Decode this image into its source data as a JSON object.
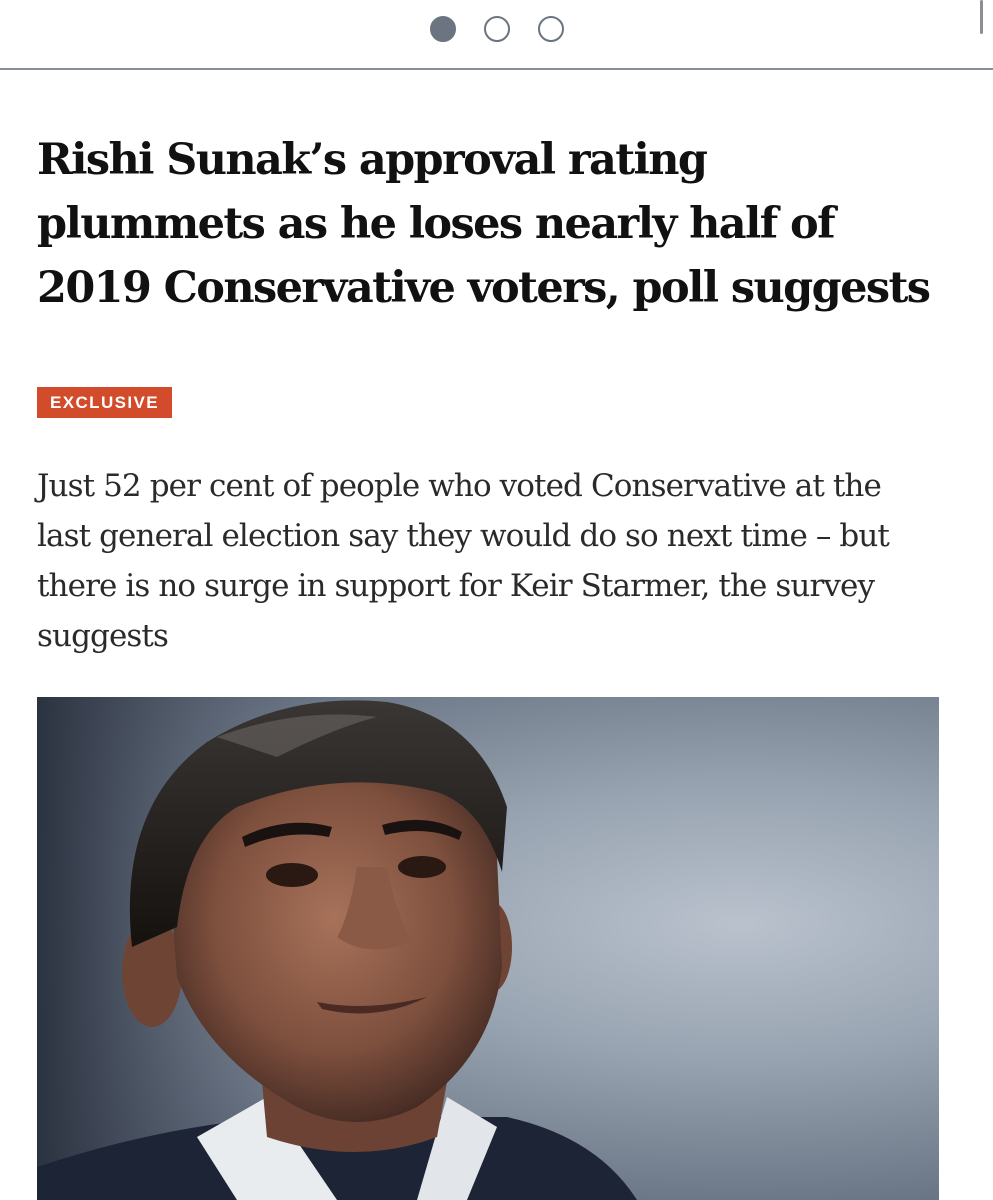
{
  "carousel": {
    "total": 3,
    "active_index": 0
  },
  "article": {
    "headline": "Rishi Sunak’s approval rating plummets as he loses nearly half of 2019 Conservative voters, poll suggests",
    "badge": "EXCLUSIVE",
    "standfirst": "Just 52 per cent of people who voted Conservative at the last general election say they would do so next time – but there is no surge in support for Keir Starmer, the survey suggests"
  },
  "colors": {
    "badge_bg": "#d24b2a",
    "dot_active": "#6b7480",
    "headline_text": "#111111",
    "body_text": "#2a2a2a"
  },
  "icons": [
    "carousel-dot-active",
    "carousel-dot-inactive"
  ]
}
